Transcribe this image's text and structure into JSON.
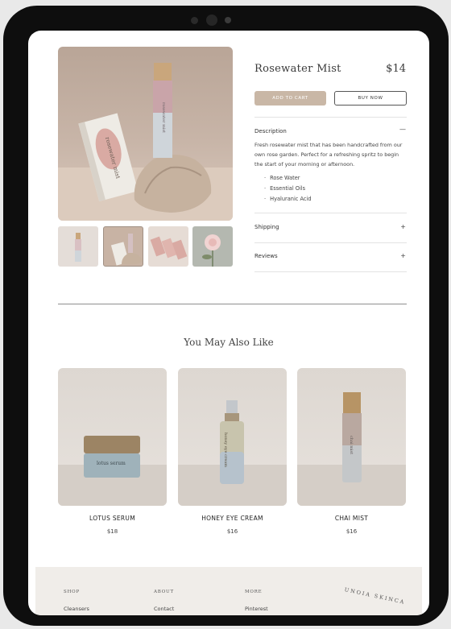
{
  "product": {
    "title": "Rosewater Mist",
    "price": "$14",
    "add_to_cart": "ADD TO CART",
    "buy_now": "BUY NOW",
    "bottle_label": "rosewater mist",
    "box_label": "rosewater mist"
  },
  "accordion": {
    "description": {
      "label": "Description",
      "sign": "—",
      "text": "Fresh rosewater mist that has been handcrafted from our own rose garden. Perfect for a refreshing spritz to begin the start of your morning or afternoon.",
      "ingredients": [
        "Rose Water",
        "Essential Oils",
        "Hyaluranic Acid"
      ]
    },
    "shipping": {
      "label": "Shipping",
      "sign": "+"
    },
    "reviews": {
      "label": "Reviews",
      "sign": "+"
    }
  },
  "related": {
    "title": "You May Also Like",
    "items": [
      {
        "name": "LOTUS SERUM",
        "price": "$18",
        "label": "lotus serum"
      },
      {
        "name": "HONEY EYE CREAM",
        "price": "$16",
        "label": "honey eye cream"
      },
      {
        "name": "CHAI MIST",
        "price": "$16",
        "label": "chai mist"
      }
    ]
  },
  "footer": {
    "shop": {
      "head": "SHOP",
      "link": "Cleansers"
    },
    "about": {
      "head": "ABOUT",
      "link": "Contact"
    },
    "more": {
      "head": "MORE",
      "link": "Pinterest"
    },
    "badge": "UNOIA SKINCA"
  }
}
